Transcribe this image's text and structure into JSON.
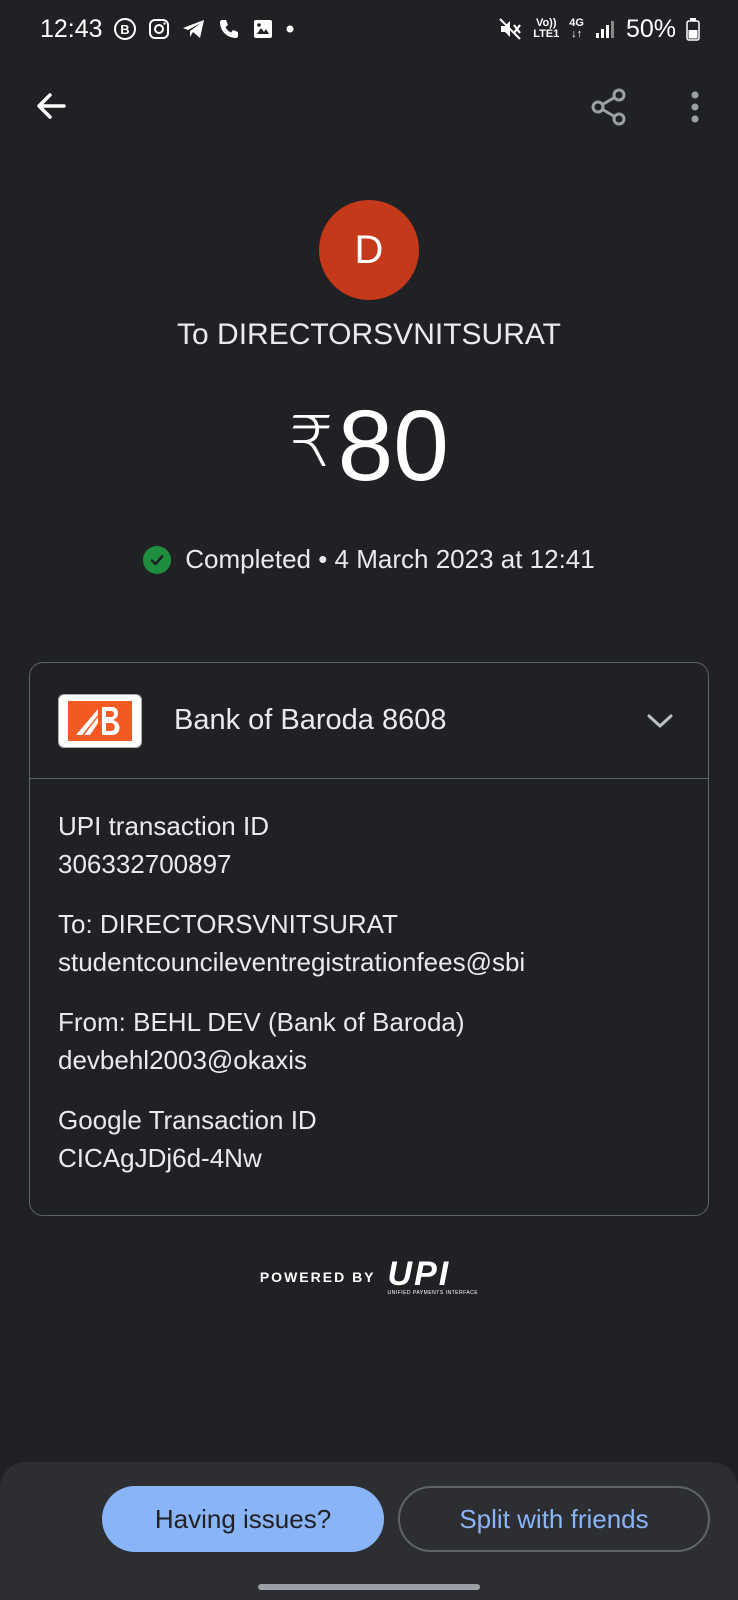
{
  "status_bar": {
    "time": "12:43",
    "network_volte": "Vo))",
    "network_lte": "LTE1",
    "network_type": "4G",
    "battery": "50%"
  },
  "toolbar": {
    "back_icon": "arrow-back-icon",
    "share_icon": "share-icon",
    "more_icon": "more-vert-icon"
  },
  "payee": {
    "avatar_letter": "D",
    "avatar_color": "#c5391b",
    "title": "To DIRECTORSVNITSURAT"
  },
  "amount": {
    "currency": "₹",
    "value": "80"
  },
  "status": {
    "text": "Completed • 4 March 2023 at 12:41",
    "color": "#1e8e3e"
  },
  "account": {
    "bank_name": "Bank of Baroda 8608",
    "logo_color": "#f15a22"
  },
  "details": [
    {
      "label": "UPI transaction ID",
      "value": "306332700897"
    },
    {
      "label": "To: DIRECTORSVNITSURAT",
      "value": "studentcouncileventregistrationfees@sbi"
    },
    {
      "label": "From: BEHL DEV (Bank of Baroda)",
      "value": "devbehl2003@okaxis"
    },
    {
      "label": "Google Transaction ID",
      "value": "CICAgJDj6d-4Nw"
    }
  ],
  "footer": {
    "powered_by": "POWERED BY",
    "upi_logo_text": "UPI",
    "upi_logo_subtitle": "UNIFIED PAYMENTS INTERFACE"
  },
  "actions": {
    "issues_label": "Having issues?",
    "split_label": "Split with friends",
    "accent": "#8ab4f8"
  }
}
